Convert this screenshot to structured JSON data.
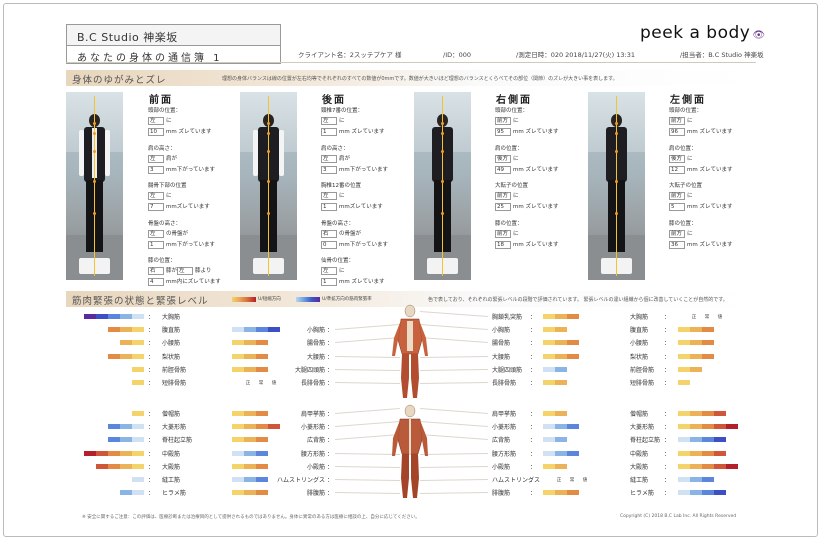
{
  "header": {
    "studio": "B.C Studio 神楽坂",
    "subtitle": "あなたの身体の通信簿 1",
    "logo": "peek a body",
    "logo_mark": "👁",
    "client": "クライアント名：2スッテプケア 様",
    "id": "/ID：000",
    "date": "/測定日時：020 2018/11/27(火) 13:31",
    "staff": "/担当者：B.C Studio 神楽坂"
  },
  "posture": {
    "title": "身体のゆがみとズレ",
    "note": "理想の身体バランスは線の位置が左右均等でそれぞれのすべての数値が0mmです。数値が大きいほど理想のバランスとくらべてその部位（関節）のズレが大きい事を表します。",
    "views": [
      {
        "title": "前面",
        "rows": [
          {
            "label": "頭部の位置：",
            "parts": [
              [
                "左"
              ],
              "に"
            ],
            "line": [
              [
                "10"
              ],
              "mm ズレています"
            ]
          },
          {
            "label": "肩の高さ：",
            "parts": [
              [
                "左"
              ],
              "肩が"
            ],
            "line": [
              [
                "3"
              ],
              "mm下がっています"
            ]
          },
          {
            "label": "腸骨下部の位置",
            "parts": [
              [
                "左"
              ],
              "に"
            ],
            "line": [
              [
                "7"
              ],
              "mmズレています"
            ]
          },
          {
            "label": "骨盤の高さ：",
            "parts": [
              [
                "左"
              ],
              "の骨盤が"
            ],
            "line": [
              [
                "1"
              ],
              "mm下がっています"
            ]
          },
          {
            "label": "膝の位置：",
            "parts": [
              [
                "右"
              ],
              "膝が",
              [
                "左"
              ],
              "膝より"
            ],
            "line": [
              [
                "4"
              ],
              "mm内にズレています"
            ]
          }
        ]
      },
      {
        "title": "後面",
        "rows": [
          {
            "label": "頸椎7番の位置：",
            "parts": [
              [
                "左"
              ],
              "に"
            ],
            "line": [
              [
                "1"
              ],
              "mm ズレています"
            ]
          },
          {
            "label": "肩の高さ：",
            "parts": [
              [
                "左"
              ],
              "肩が"
            ],
            "line": [
              [
                "3"
              ],
              "mm下がっています"
            ]
          },
          {
            "label": "胸椎12番の位置",
            "parts": [
              [
                "左"
              ],
              "に"
            ],
            "line": [
              [
                "1"
              ],
              "mmズレています"
            ]
          },
          {
            "label": "骨盤の高さ：",
            "parts": [
              [
                "右"
              ],
              "の骨盤が"
            ],
            "line": [
              [
                "0"
              ],
              "mm下がっています"
            ]
          },
          {
            "label": "仙骨の位置：",
            "parts": [
              [
                "左"
              ],
              "に"
            ],
            "line": [
              [
                "1"
              ],
              "mm ズレています"
            ]
          }
        ]
      },
      {
        "title": "右側面",
        "rows": [
          {
            "label": "頭部の位置：",
            "parts": [
              [
                "前方"
              ],
              "に"
            ],
            "line": [
              [
                "95"
              ],
              "mm ズレています"
            ]
          },
          {
            "label": "肩の位置：",
            "parts": [
              [
                "後方"
              ],
              "に"
            ],
            "line": [
              [
                "49"
              ],
              "mm ズレています"
            ]
          },
          {
            "label": "大転子の位置",
            "parts": [
              [
                "前方"
              ],
              "に"
            ],
            "line": [
              [
                "25"
              ],
              "mm ズレています"
            ]
          },
          {
            "label": "膝の位置：",
            "parts": [
              [
                "前方"
              ],
              "に"
            ],
            "line": [
              [
                "18"
              ],
              "mm ズレています"
            ]
          }
        ]
      },
      {
        "title": "左側面",
        "rows": [
          {
            "label": "頭部の位置：",
            "parts": [
              [
                "前方"
              ],
              "に"
            ],
            "line": [
              [
                "96"
              ],
              "mm ズレています"
            ]
          },
          {
            "label": "肩の位置：",
            "parts": [
              [
                "後方"
              ],
              "に"
            ],
            "line": [
              [
                "12"
              ],
              "mm ズレています"
            ]
          },
          {
            "label": "大転子の位置",
            "parts": [
              [
                "前方"
              ],
              "に"
            ],
            "line": [
              [
                "5"
              ],
              "mm ズレています"
            ]
          },
          {
            "label": "膝の位置：",
            "parts": [
              [
                "前方"
              ],
              "に"
            ],
            "line": [
              [
                "36"
              ],
              "mm ズレています"
            ]
          }
        ]
      }
    ]
  },
  "muscle": {
    "title": "筋肉緊張の状態と緊張レベル",
    "legend_left": "U/短縮方向",
    "legend_right": "U/準拡方向の筋肉緊張率",
    "note": "色で表しており、それぞれの緊張レベルの段階で評価されています。 緊張レベルの違い組織から個に改善していくことが自然的です。",
    "normal": "正　常　値",
    "upper_left": [
      "大胸筋",
      "腹直筋",
      "小腰筋",
      "梨状筋",
      "前脛骨筋",
      "短腓骨筋"
    ],
    "upper_mid_left": [
      "小胸筋",
      "腸骨筋",
      "大腰筋",
      "大腿四頭筋",
      "長腓骨筋"
    ],
    "upper_mid_right": [
      "胸鎖乳突筋",
      "小胸筋",
      "腸骨筋",
      "大腰筋",
      "大腿四頭筋",
      "長腓骨筋"
    ],
    "upper_right": [
      "大胸筋",
      "腹直筋",
      "小腰筋",
      "梨状筋",
      "前脛骨筋",
      "短腓骨筋"
    ],
    "lower_left": [
      "僧帽筋",
      "大菱形筋",
      "脊柱起立筋",
      "中殿筋",
      "大殿筋",
      "縫工筋",
      "ヒラメ筋"
    ],
    "lower_mid_left": [
      "肩甲挙筋",
      "小菱形筋",
      "広背筋",
      "腰方形筋",
      "小殿筋",
      "ハムストリングス",
      "腓腹筋"
    ],
    "lower_mid_right": [
      "肩甲挙筋",
      "小菱形筋",
      "広背筋",
      "腰方形筋",
      "小殿筋",
      "ハムストリングス",
      "腓腹筋"
    ],
    "lower_right": [
      "僧帽筋",
      "大菱形筋",
      "脊柱起立筋",
      "中殿筋",
      "大殿筋",
      "縫工筋",
      "ヒラメ筋"
    ]
  },
  "footer": {
    "left": "※ 安全に関するご注意：この評価は、医療診断または治療目的として提供されるものではありません。身体に異常のある方は医療に相談の上、自分に応じてください。",
    "right": "Copyright (C) 2018 B.C Lab Inc. All Rights Reserved"
  }
}
